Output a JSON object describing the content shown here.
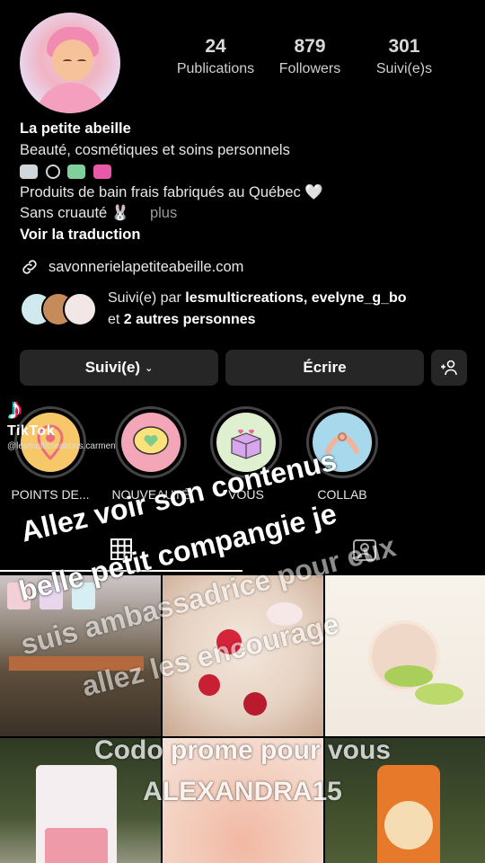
{
  "profile": {
    "stats": [
      {
        "value": "24",
        "label": "Publications"
      },
      {
        "value": "879",
        "label": "Followers"
      },
      {
        "value": "301",
        "label": "Suivi(e)s"
      }
    ],
    "name": "La petite abeille",
    "category": "Beauté, cosmétiques et soins personnels",
    "bio_line2": "Produits de bain frais fabriqués au Québec 🤍",
    "bio_line3": "Sans cruauté 🐰",
    "more": "plus",
    "translate": "Voir la traduction",
    "website": "savonnerielapetiteabeille.com",
    "followed_prefix": "Suivi(e) par ",
    "followed_names": "lesmulticreations, evelyne_g_bo",
    "followed_and": "et ",
    "followed_others": "2 autres personnes"
  },
  "buttons": {
    "following": "Suivi(e)",
    "message": "Écrire",
    "add_user": "+👤"
  },
  "highlights": [
    {
      "label": "POINTS DE...",
      "color": "#f6c86a"
    },
    {
      "label": "NOUVEAUTÉ",
      "color": "#f3a6b8"
    },
    {
      "label": "VOUS",
      "color": "#dff0d0"
    },
    {
      "label": "COLLAB",
      "color": "#a8d8ec"
    }
  ],
  "tiktok": {
    "word": "TikTok",
    "user": "@lesmulticreations.carmen"
  },
  "overlay": {
    "line1": "Allez voir son contenus",
    "line2": "belle petit compangie  je",
    "line3": "suis ambassadrice pour eux",
    "line4": "allez les encourage",
    "line5": "Codo prome pour vous",
    "line6": "ALEXANDRA15"
  },
  "colors": {
    "background": "#000000",
    "button_bg": "#262626"
  }
}
